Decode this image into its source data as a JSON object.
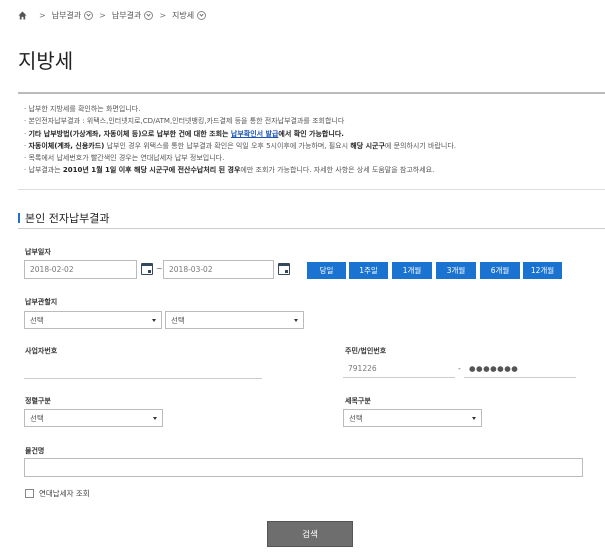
{
  "breadcrumb": {
    "items": [
      "납부결과",
      "납부결과",
      "지방세"
    ]
  },
  "page_title": "지방세",
  "notice": {
    "line1": "납부한 지방세를 확인하는 화면입니다.",
    "line2": "본인전자납부결과 : 위택스,인터넷지로,CD/ATM,인터넷뱅킹,카드결제 등을 통한 전자납부결과를 조회합니다",
    "line3_a": "기타 납부방법(가상계좌, 자동이체 등)으로 납부한 건에 대한 조회는 ",
    "line3_link": "납부확인서 발급",
    "line3_b": "에서 확인 가능합니다.",
    "line4_a": "자동이체(계좌, 신용카드)",
    "line4_b": " 납부인 경우 위택스를 통한 납부결과 확인은 익일 오후 5시이후에 가능하며, 필요시 ",
    "line4_c": "해당 시군구",
    "line4_d": "에 문의하시기 바랍니다.",
    "line5": "목록에서 납세번호가 빨간색인 경우는 연대납세자 납부 정보입니다.",
    "line6_a": "납부결과는 ",
    "line6_b": "2010년 1월 1일 이후 해당 시군구에 전산수납처리 된 경우",
    "line6_c": "에만 조회가 가능합니다. 자세한 사항은 상세 도움말을 참고하세요."
  },
  "section_title": "본인 전자납부결과",
  "form": {
    "payment_date_label": "납부일자",
    "date_from": "2018-02-02",
    "date_sep": "~",
    "date_to": "2018-03-02",
    "period_buttons": [
      "당일",
      "1주일",
      "1개월",
      "3개월",
      "6개월",
      "12개월"
    ],
    "jurisdiction_label": "납부관할지",
    "jurisdiction_sido": "선택",
    "jurisdiction_sigungu": "선택",
    "business_no_label": "사업자번호",
    "business_no_value": "",
    "resident_no_label": "주민/법인번호",
    "resident_no_front": "791226",
    "resident_no_sep": "-",
    "resident_no_back": "●●●●●●●",
    "collection_type_label": "정렬구분",
    "collection_type_value": "선택",
    "tax_item_label": "세목구분",
    "tax_item_value": "선택",
    "object_name_label": "물건명",
    "object_name_value": "",
    "joint_taxpayer_label": "연대납세자 조회",
    "search_button": "검색"
  }
}
